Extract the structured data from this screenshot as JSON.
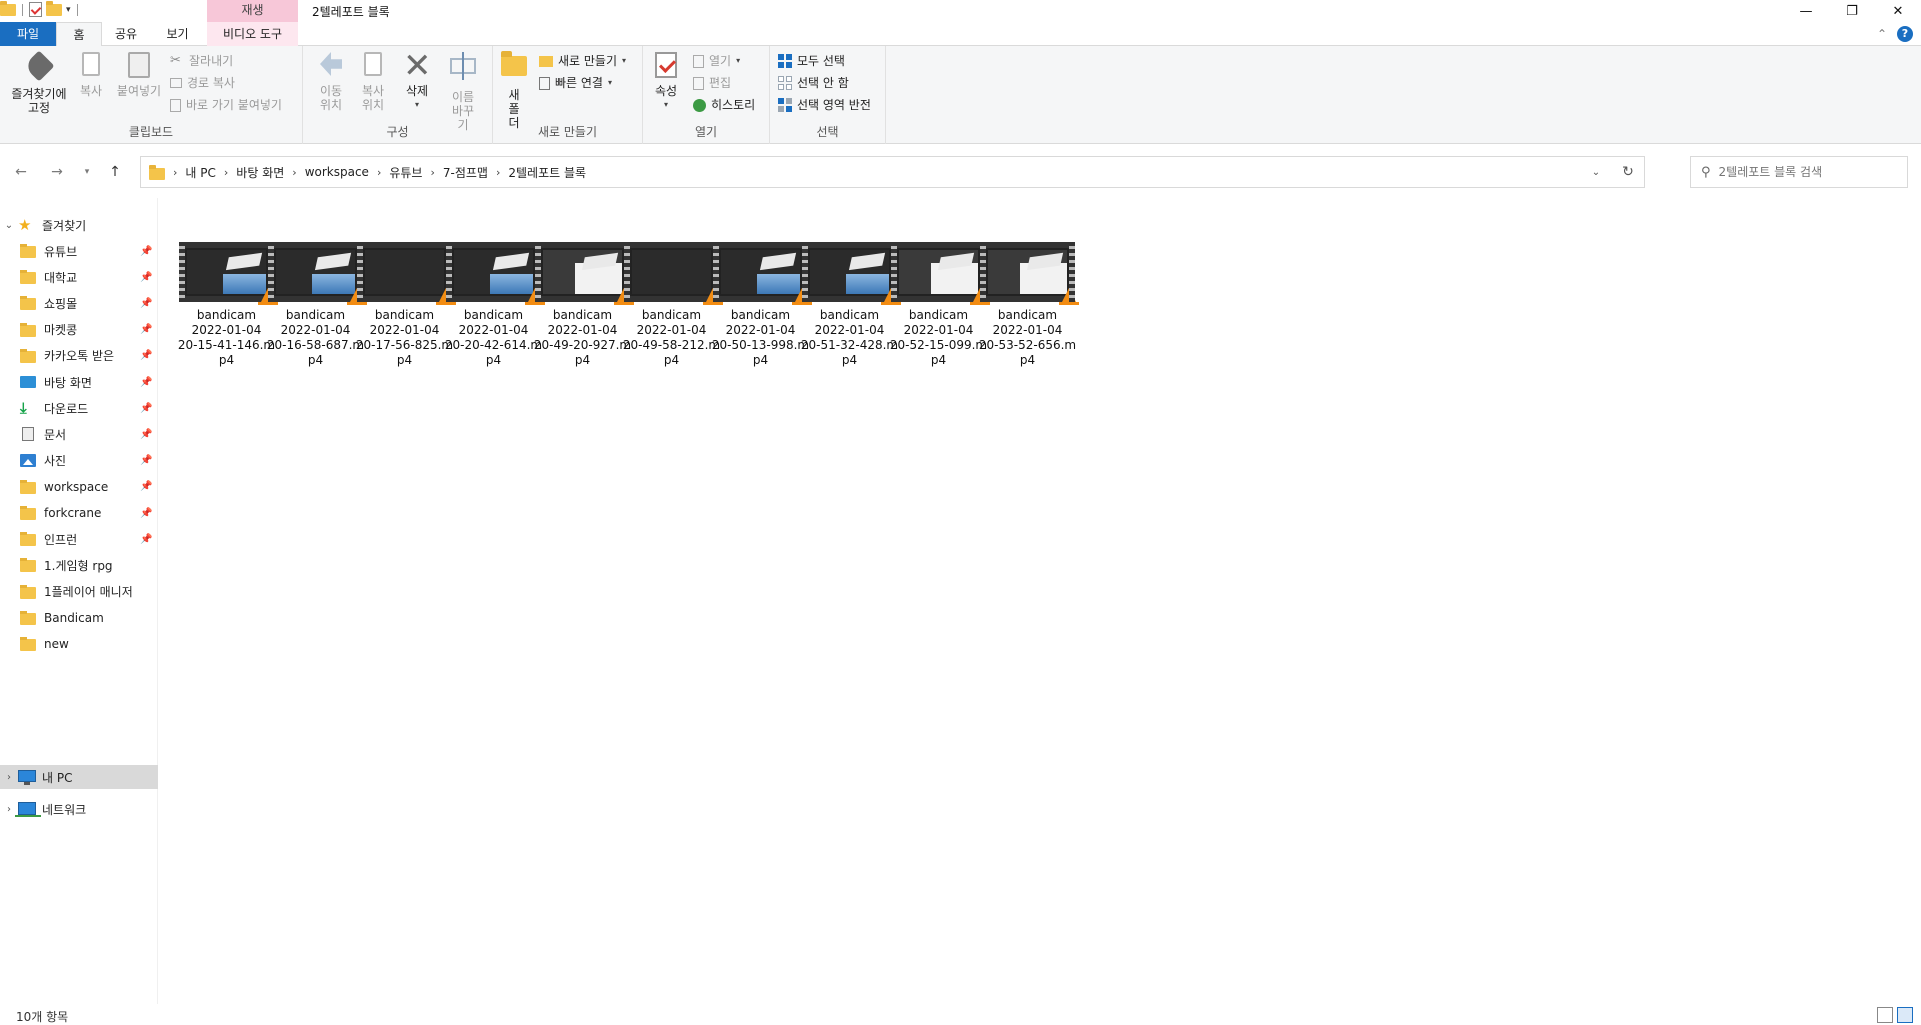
{
  "window": {
    "title": "2텔레포트 블록",
    "context_tab_header": "재생",
    "controls": {
      "minimize": "—",
      "restore": "❐",
      "close": "✕"
    }
  },
  "tabs": [
    {
      "label": "파일",
      "name": "tab-file"
    },
    {
      "label": "홈",
      "name": "tab-home"
    },
    {
      "label": "공유",
      "name": "tab-share"
    },
    {
      "label": "보기",
      "name": "tab-view"
    },
    {
      "label": "비디오 도구",
      "name": "tab-video-tools"
    }
  ],
  "ribbon": {
    "clipboard": {
      "label": "클립보드",
      "pin": "즐겨찾기에 고정",
      "copy": "복사",
      "paste": "붙여넣기",
      "cut": "잘라내기",
      "copy_path": "경로 복사",
      "paste_shortcut": "바로 가기 붙여넣기"
    },
    "organize": {
      "label": "구성",
      "move_to": "이동 위치",
      "copy_to": "복사 위치",
      "delete": "삭제",
      "rename": "이름 바꾸기"
    },
    "new": {
      "label": "새로 만들기",
      "new_folder": "새 폴더",
      "new_item": "새로 만들기",
      "easy_access": "빠른 연결"
    },
    "open": {
      "label": "열기",
      "properties": "속성",
      "open": "열기",
      "edit": "편집",
      "history": "히스토리"
    },
    "select": {
      "label": "선택",
      "select_all": "모두 선택",
      "select_none": "선택 안 함",
      "invert": "선택 영역 반전"
    }
  },
  "address": {
    "crumbs": [
      "내 PC",
      "바탕 화면",
      "workspace",
      "유튜브",
      "7-점프맵",
      "2텔레포트 블록"
    ]
  },
  "search": {
    "placeholder": "2텔레포트 블록 검색"
  },
  "sidebar": {
    "quick_access": "즐겨찾기",
    "items": [
      {
        "label": "유튜브",
        "icon": "folder",
        "pinned": true
      },
      {
        "label": "대학교",
        "icon": "folder",
        "pinned": true
      },
      {
        "label": "쇼핑몰",
        "icon": "folder",
        "pinned": true
      },
      {
        "label": "마켓콩",
        "icon": "folder",
        "pinned": true
      },
      {
        "label": "카카오톡 받은",
        "icon": "folder",
        "pinned": true
      },
      {
        "label": "바탕 화면",
        "icon": "desktop",
        "pinned": true
      },
      {
        "label": "다운로드",
        "icon": "download",
        "pinned": true
      },
      {
        "label": "문서",
        "icon": "document",
        "pinned": true
      },
      {
        "label": "사진",
        "icon": "pictures",
        "pinned": true
      },
      {
        "label": "workspace",
        "icon": "folder",
        "pinned": true
      },
      {
        "label": "forkcrane",
        "icon": "folder",
        "pinned": true
      },
      {
        "label": "인프런",
        "icon": "folder",
        "pinned": true
      },
      {
        "label": "1.게임형 rpg",
        "icon": "folder",
        "pinned": false
      },
      {
        "label": "1플레이어 매니저",
        "icon": "folder",
        "pinned": false
      },
      {
        "label": "Bandicam",
        "icon": "folder",
        "pinned": false
      },
      {
        "label": "new",
        "icon": "folder",
        "pinned": false
      }
    ],
    "this_pc": "내 PC",
    "network": "네트워크"
  },
  "files": [
    {
      "line1": "bandicam",
      "line2": "2022-01-04",
      "line3": "20-15-41-146.m",
      "line4": "p4",
      "thumb": "scene"
    },
    {
      "line1": "bandicam",
      "line2": "2022-01-04",
      "line3": "20-16-58-687.m",
      "line4": "p4",
      "thumb": "scene"
    },
    {
      "line1": "bandicam",
      "line2": "2022-01-04",
      "line3": "20-17-56-825.m",
      "line4": "p4",
      "thumb": "dark"
    },
    {
      "line1": "bandicam",
      "line2": "2022-01-04",
      "line3": "20-20-42-614.m",
      "line4": "p4",
      "thumb": "scene"
    },
    {
      "line1": "bandicam",
      "line2": "2022-01-04",
      "line3": "20-49-20-927.m",
      "line4": "p4",
      "thumb": "white"
    },
    {
      "line1": "bandicam",
      "line2": "2022-01-04",
      "line3": "20-49-58-212.m",
      "line4": "p4",
      "thumb": "dark"
    },
    {
      "line1": "bandicam",
      "line2": "2022-01-04",
      "line3": "20-50-13-998.m",
      "line4": "p4",
      "thumb": "scene"
    },
    {
      "line1": "bandicam",
      "line2": "2022-01-04",
      "line3": "20-51-32-428.m",
      "line4": "p4",
      "thumb": "scene"
    },
    {
      "line1": "bandicam",
      "line2": "2022-01-04",
      "line3": "20-52-15-099.m",
      "line4": "p4",
      "thumb": "white"
    },
    {
      "line1": "bandicam",
      "line2": "2022-01-04",
      "line3": "20-53-52-656.m",
      "line4": "p4",
      "thumb": "white"
    }
  ],
  "status": {
    "count": "10개 항목"
  },
  "colors": {
    "accent": "#1a6ec1",
    "context_tab": "#f7c7d8",
    "folder": "#f4c44a",
    "vlc_cone": "#f28c12"
  }
}
